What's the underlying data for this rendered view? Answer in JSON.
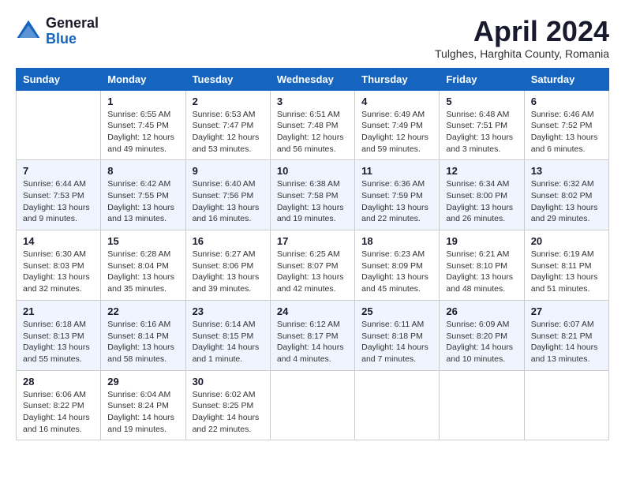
{
  "header": {
    "logo_general": "General",
    "logo_blue": "Blue",
    "month_title": "April 2024",
    "location": "Tulghes, Harghita County, Romania"
  },
  "weekdays": [
    "Sunday",
    "Monday",
    "Tuesday",
    "Wednesday",
    "Thursday",
    "Friday",
    "Saturday"
  ],
  "weeks": [
    [
      {
        "day": "",
        "sunrise": "",
        "sunset": "",
        "daylight": ""
      },
      {
        "day": "1",
        "sunrise": "Sunrise: 6:55 AM",
        "sunset": "Sunset: 7:45 PM",
        "daylight": "Daylight: 12 hours and 49 minutes."
      },
      {
        "day": "2",
        "sunrise": "Sunrise: 6:53 AM",
        "sunset": "Sunset: 7:47 PM",
        "daylight": "Daylight: 12 hours and 53 minutes."
      },
      {
        "day": "3",
        "sunrise": "Sunrise: 6:51 AM",
        "sunset": "Sunset: 7:48 PM",
        "daylight": "Daylight: 12 hours and 56 minutes."
      },
      {
        "day": "4",
        "sunrise": "Sunrise: 6:49 AM",
        "sunset": "Sunset: 7:49 PM",
        "daylight": "Daylight: 12 hours and 59 minutes."
      },
      {
        "day": "5",
        "sunrise": "Sunrise: 6:48 AM",
        "sunset": "Sunset: 7:51 PM",
        "daylight": "Daylight: 13 hours and 3 minutes."
      },
      {
        "day": "6",
        "sunrise": "Sunrise: 6:46 AM",
        "sunset": "Sunset: 7:52 PM",
        "daylight": "Daylight: 13 hours and 6 minutes."
      }
    ],
    [
      {
        "day": "7",
        "sunrise": "Sunrise: 6:44 AM",
        "sunset": "Sunset: 7:53 PM",
        "daylight": "Daylight: 13 hours and 9 minutes."
      },
      {
        "day": "8",
        "sunrise": "Sunrise: 6:42 AM",
        "sunset": "Sunset: 7:55 PM",
        "daylight": "Daylight: 13 hours and 13 minutes."
      },
      {
        "day": "9",
        "sunrise": "Sunrise: 6:40 AM",
        "sunset": "Sunset: 7:56 PM",
        "daylight": "Daylight: 13 hours and 16 minutes."
      },
      {
        "day": "10",
        "sunrise": "Sunrise: 6:38 AM",
        "sunset": "Sunset: 7:58 PM",
        "daylight": "Daylight: 13 hours and 19 minutes."
      },
      {
        "day": "11",
        "sunrise": "Sunrise: 6:36 AM",
        "sunset": "Sunset: 7:59 PM",
        "daylight": "Daylight: 13 hours and 22 minutes."
      },
      {
        "day": "12",
        "sunrise": "Sunrise: 6:34 AM",
        "sunset": "Sunset: 8:00 PM",
        "daylight": "Daylight: 13 hours and 26 minutes."
      },
      {
        "day": "13",
        "sunrise": "Sunrise: 6:32 AM",
        "sunset": "Sunset: 8:02 PM",
        "daylight": "Daylight: 13 hours and 29 minutes."
      }
    ],
    [
      {
        "day": "14",
        "sunrise": "Sunrise: 6:30 AM",
        "sunset": "Sunset: 8:03 PM",
        "daylight": "Daylight: 13 hours and 32 minutes."
      },
      {
        "day": "15",
        "sunrise": "Sunrise: 6:28 AM",
        "sunset": "Sunset: 8:04 PM",
        "daylight": "Daylight: 13 hours and 35 minutes."
      },
      {
        "day": "16",
        "sunrise": "Sunrise: 6:27 AM",
        "sunset": "Sunset: 8:06 PM",
        "daylight": "Daylight: 13 hours and 39 minutes."
      },
      {
        "day": "17",
        "sunrise": "Sunrise: 6:25 AM",
        "sunset": "Sunset: 8:07 PM",
        "daylight": "Daylight: 13 hours and 42 minutes."
      },
      {
        "day": "18",
        "sunrise": "Sunrise: 6:23 AM",
        "sunset": "Sunset: 8:09 PM",
        "daylight": "Daylight: 13 hours and 45 minutes."
      },
      {
        "day": "19",
        "sunrise": "Sunrise: 6:21 AM",
        "sunset": "Sunset: 8:10 PM",
        "daylight": "Daylight: 13 hours and 48 minutes."
      },
      {
        "day": "20",
        "sunrise": "Sunrise: 6:19 AM",
        "sunset": "Sunset: 8:11 PM",
        "daylight": "Daylight: 13 hours and 51 minutes."
      }
    ],
    [
      {
        "day": "21",
        "sunrise": "Sunrise: 6:18 AM",
        "sunset": "Sunset: 8:13 PM",
        "daylight": "Daylight: 13 hours and 55 minutes."
      },
      {
        "day": "22",
        "sunrise": "Sunrise: 6:16 AM",
        "sunset": "Sunset: 8:14 PM",
        "daylight": "Daylight: 13 hours and 58 minutes."
      },
      {
        "day": "23",
        "sunrise": "Sunrise: 6:14 AM",
        "sunset": "Sunset: 8:15 PM",
        "daylight": "Daylight: 14 hours and 1 minute."
      },
      {
        "day": "24",
        "sunrise": "Sunrise: 6:12 AM",
        "sunset": "Sunset: 8:17 PM",
        "daylight": "Daylight: 14 hours and 4 minutes."
      },
      {
        "day": "25",
        "sunrise": "Sunrise: 6:11 AM",
        "sunset": "Sunset: 8:18 PM",
        "daylight": "Daylight: 14 hours and 7 minutes."
      },
      {
        "day": "26",
        "sunrise": "Sunrise: 6:09 AM",
        "sunset": "Sunset: 8:20 PM",
        "daylight": "Daylight: 14 hours and 10 minutes."
      },
      {
        "day": "27",
        "sunrise": "Sunrise: 6:07 AM",
        "sunset": "Sunset: 8:21 PM",
        "daylight": "Daylight: 14 hours and 13 minutes."
      }
    ],
    [
      {
        "day": "28",
        "sunrise": "Sunrise: 6:06 AM",
        "sunset": "Sunset: 8:22 PM",
        "daylight": "Daylight: 14 hours and 16 minutes."
      },
      {
        "day": "29",
        "sunrise": "Sunrise: 6:04 AM",
        "sunset": "Sunset: 8:24 PM",
        "daylight": "Daylight: 14 hours and 19 minutes."
      },
      {
        "day": "30",
        "sunrise": "Sunrise: 6:02 AM",
        "sunset": "Sunset: 8:25 PM",
        "daylight": "Daylight: 14 hours and 22 minutes."
      },
      {
        "day": "",
        "sunrise": "",
        "sunset": "",
        "daylight": ""
      },
      {
        "day": "",
        "sunrise": "",
        "sunset": "",
        "daylight": ""
      },
      {
        "day": "",
        "sunrise": "",
        "sunset": "",
        "daylight": ""
      },
      {
        "day": "",
        "sunrise": "",
        "sunset": "",
        "daylight": ""
      }
    ]
  ]
}
